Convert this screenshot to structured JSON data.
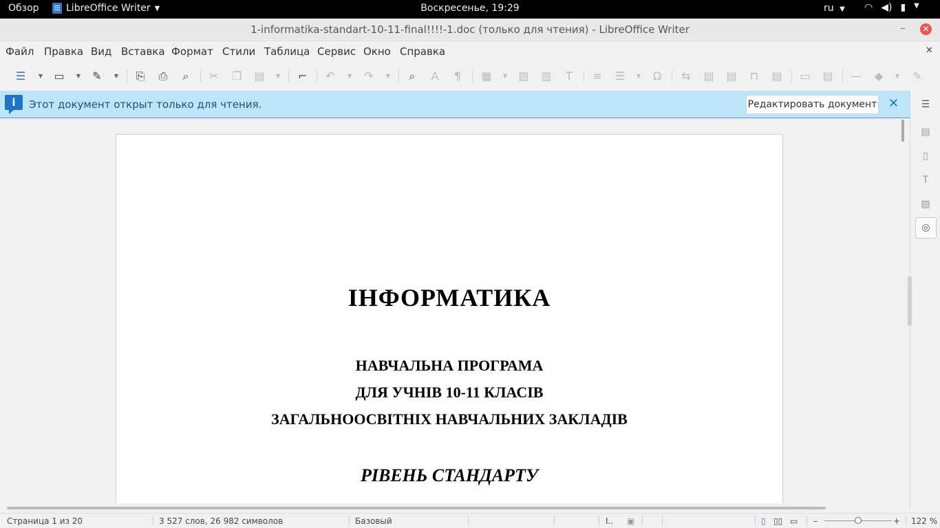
{
  "topbar": {
    "overview": "Обзор",
    "app_name": "LibreOffice Writer",
    "clock": "Воскресенье, 19:29",
    "lang": "ru"
  },
  "window": {
    "title": "1-informatika-standart-10-11-final!!!!-1.doc (только для чтения) - LibreOffice Writer",
    "close_glyph": "✕",
    "min_glyph": "–"
  },
  "menu": {
    "items": [
      "Файл",
      "Правка",
      "Вид",
      "Вставка",
      "Формат",
      "Стили",
      "Таблица",
      "Сервис",
      "Окно",
      "Справка"
    ],
    "close_glyph": "✕"
  },
  "infobar": {
    "icon": "i",
    "message": "Этот документ открыт только для чтения.",
    "edit_button": "Редактировать документ",
    "close_glyph": "✕"
  },
  "document": {
    "title": "ІНФОРМАТИКА",
    "line1": "НАВЧАЛЬНА ПРОГРАМА",
    "line2": "ДЛЯ УЧНІВ 10-11 КЛАСІВ",
    "line3": "ЗАГАЛЬНООСВІТНІХ НАВЧАЛЬНИХ ЗАКЛАДІВ",
    "line4": "РІВЕНЬ СТАНДАРТУ"
  },
  "statusbar": {
    "page": "Страница 1 из 20",
    "words": "3 527 слов, 26 982 символов",
    "style": "Базовый",
    "zoom": "122 %",
    "zoom_minus": "–",
    "zoom_plus": "+"
  },
  "icons": {
    "toolbar": [
      "toggle-sidebar-icon",
      "open-icon",
      "save-icon",
      "export-pdf-icon",
      "print-icon",
      "print-preview-icon",
      "cut-icon",
      "copy-icon",
      "paste-icon",
      "clone-formatting-icon",
      "undo-icon",
      "redo-icon",
      "find-replace-icon",
      "spelling-icon",
      "formatting-marks-icon",
      "insert-table-icon",
      "insert-image-icon",
      "insert-chart-icon",
      "insert-textbox-icon",
      "page-break-icon",
      "insert-field-icon",
      "special-character-icon",
      "hyperlink-icon",
      "footnote-icon",
      "endnote-icon",
      "bookmark-icon",
      "cross-reference-icon",
      "comment-icon",
      "track-changes-icon",
      "insert-line-icon",
      "basic-shapes-icon",
      "draw-functions-icon"
    ],
    "sidebar": [
      "properties-icon",
      "page-icon",
      "styles-icon",
      "gallery-icon",
      "navigator-icon"
    ]
  }
}
